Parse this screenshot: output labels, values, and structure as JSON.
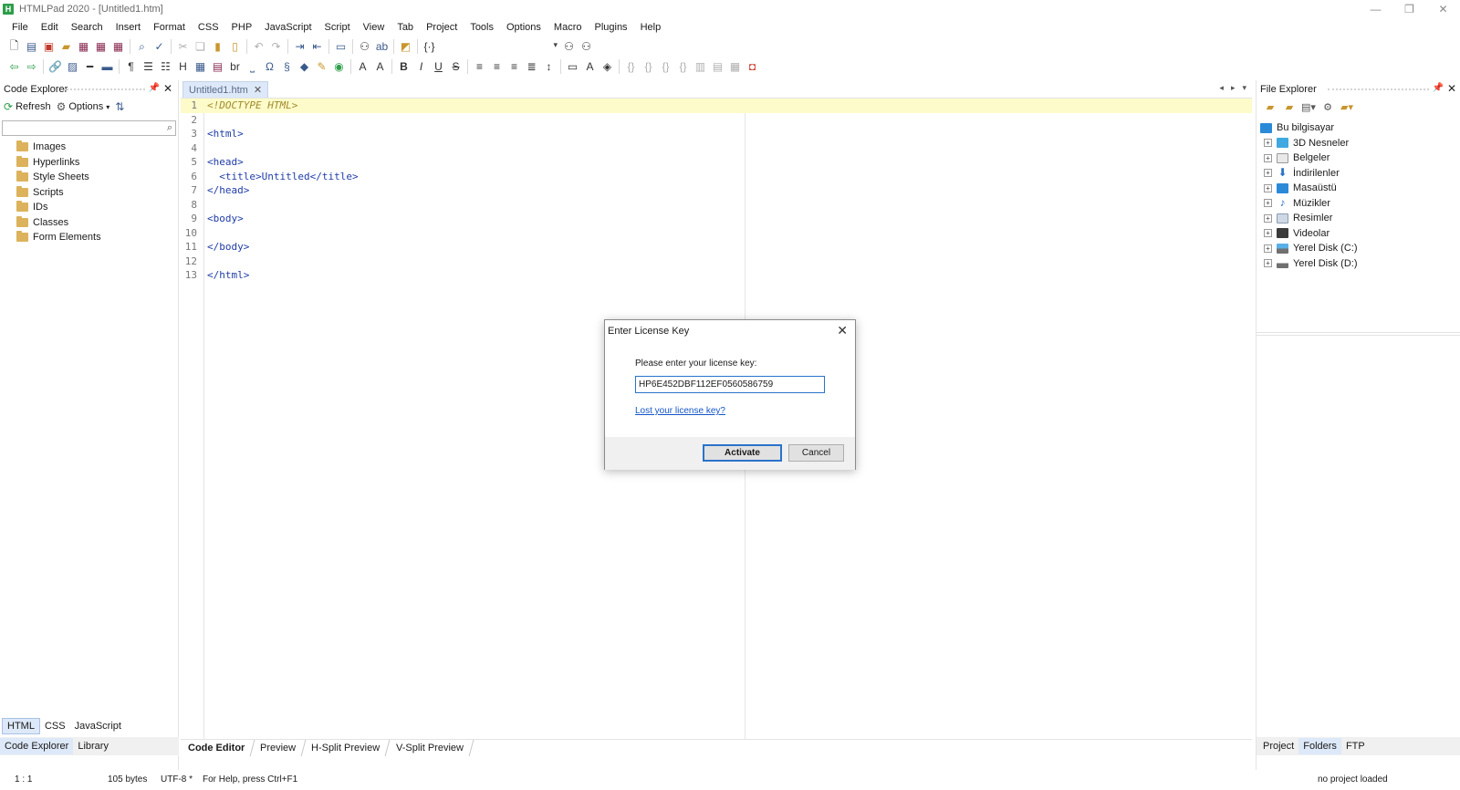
{
  "window": {
    "title": "HTMLPad 2020 - [Untitled1.htm]",
    "app_icon_letter": "H"
  },
  "menu": [
    "File",
    "Edit",
    "Search",
    "Insert",
    "Format",
    "CSS",
    "PHP",
    "JavaScript",
    "Script",
    "View",
    "Tab",
    "Project",
    "Tools",
    "Options",
    "Macro",
    "Plugins",
    "Help"
  ],
  "code_explorer": {
    "title": "Code Explorer",
    "refresh_label": "Refresh",
    "options_label": "Options",
    "tree": [
      "Images",
      "Hyperlinks",
      "Style Sheets",
      "Scripts",
      "IDs",
      "Classes",
      "Form Elements"
    ],
    "lang_tabs": [
      "HTML",
      "CSS",
      "JavaScript"
    ],
    "panel_tabs": [
      "Code Explorer",
      "Library"
    ]
  },
  "editor": {
    "tab_label": "Untitled1.htm",
    "lines": [
      {
        "n": "1",
        "code": "<!DOCTYPE HTML>"
      },
      {
        "n": "2",
        "code": ""
      },
      {
        "n": "3",
        "code": "<html>"
      },
      {
        "n": "4",
        "code": ""
      },
      {
        "n": "5",
        "code": "<head>"
      },
      {
        "n": "6",
        "code": "  <title>Untitled</title>"
      },
      {
        "n": "7",
        "code": "</head>"
      },
      {
        "n": "8",
        "code": ""
      },
      {
        "n": "9",
        "code": "<body>"
      },
      {
        "n": "10",
        "code": ""
      },
      {
        "n": "11",
        "code": "</body>"
      },
      {
        "n": "12",
        "code": ""
      },
      {
        "n": "13",
        "code": "</html>"
      }
    ],
    "bottom_tabs": [
      "Code Editor",
      "Preview",
      "H-Split Preview",
      "V-Split Preview"
    ]
  },
  "file_explorer": {
    "title": "File Explorer",
    "root": "Bu bilgisayar",
    "items": [
      "3D Nesneler",
      "Belgeler",
      "İndirilenler",
      "Masaüstü",
      "Müzikler",
      "Resimler",
      "Videolar",
      "Yerel Disk (C:)",
      "Yerel Disk (D:)"
    ],
    "bottom_tabs": [
      "Project",
      "Folders",
      "FTP"
    ]
  },
  "status": {
    "position": "1 : 1",
    "size": "105 bytes",
    "encoding": "UTF-8 *",
    "help": "For Help, press Ctrl+F1",
    "project": "no project loaded"
  },
  "dialog": {
    "title": "Enter License Key",
    "prompt": "Please enter your license key:",
    "license_value": "HP6E452DBF112EF0560586759",
    "lost_link": "Lost your license key?",
    "activate_label": "Activate",
    "cancel_label": "Cancel"
  },
  "colors": {
    "current_line": "#fdfbc9",
    "tag": "#1f3ca8",
    "doctype": "#a08a2e",
    "accent": "#2b73c9",
    "tab_active": "#dde8f8"
  }
}
